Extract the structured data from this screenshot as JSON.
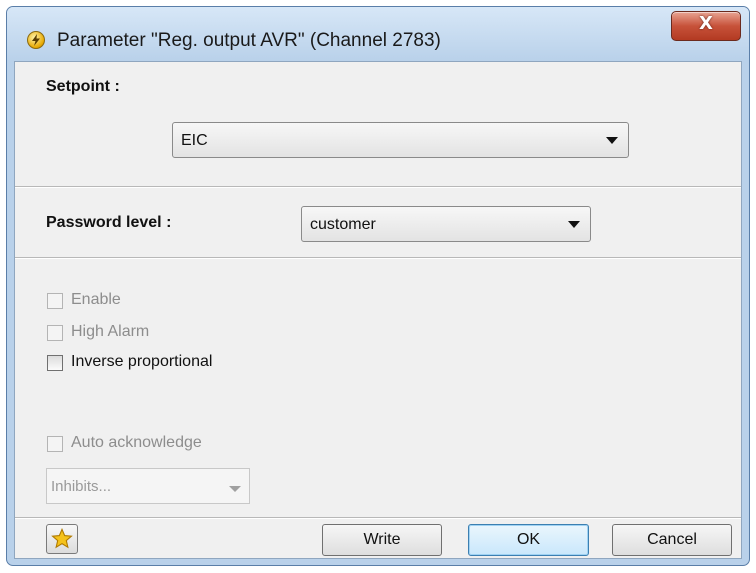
{
  "window": {
    "title": "Parameter \"Reg. output AVR\" (Channel 2783)",
    "close_glyph": "X",
    "app_icon": "lightning-circle-icon"
  },
  "setpoint": {
    "label": "Setpoint :",
    "selected": "EIC"
  },
  "password": {
    "label": "Password level :",
    "selected": "customer"
  },
  "options": {
    "enable": {
      "label": "Enable",
      "checked": false,
      "enabled": false
    },
    "high_alarm": {
      "label": "High Alarm",
      "checked": false,
      "enabled": false
    },
    "inverse_proportional": {
      "label": "Inverse proportional",
      "checked": false,
      "enabled": true
    },
    "auto_acknowledge": {
      "label": "Auto acknowledge",
      "checked": false,
      "enabled": false
    }
  },
  "inhibits": {
    "value": "Inhibits..."
  },
  "buttons": {
    "favorite_icon": "star-icon",
    "write": "Write",
    "ok": "OK",
    "cancel": "Cancel"
  },
  "colors": {
    "title_bar": "#b9d1ea",
    "close_button": "#c7523a",
    "client_bg": "#f0f0f0",
    "default_button": "#c9e7fb"
  }
}
